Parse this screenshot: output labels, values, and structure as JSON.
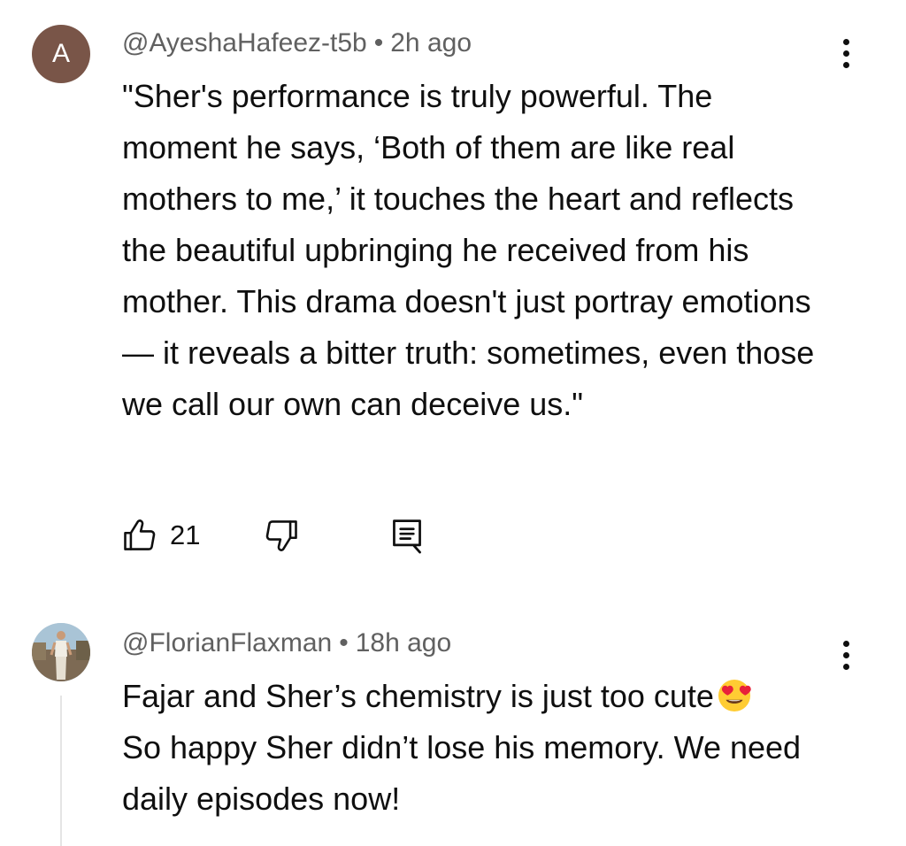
{
  "comments": [
    {
      "avatar_letter": "A",
      "avatar_color": "#795548",
      "author": "@AyeshaHafeez-t5b",
      "separator": "•",
      "time": "2h ago",
      "text": "\"Sher's performance is truly powerful. The moment he says, ‘Both of them are like real mothers to me,’ it touches the heart and reflects the beautiful upbringing he received from his mother. This drama doesn't just portray emotions — it reveals a bitter truth: sometimes, even those we call our own can deceive us.\"",
      "like_count": "21",
      "icons": {
        "like": "thumbs-up-icon",
        "dislike": "thumbs-down-icon",
        "reply": "reply-icon",
        "menu": "more-vert-icon"
      }
    },
    {
      "avatar": "profile-photo",
      "author": "@FlorianFlaxman",
      "separator": "•",
      "time": "18h ago",
      "text": "Fajar and Sher’s chemistry is just too cute",
      "text_emoji": "smiling-face-with-heart-eyes",
      "text_2": "So happy Sher didn’t lose his memory. We need daily episodes now!",
      "icons": {
        "menu": "more-vert-icon"
      }
    }
  ],
  "colors": {
    "text_primary": "#0f0f0f",
    "text_secondary": "#606060",
    "thread_line": "#e5e5e5"
  }
}
